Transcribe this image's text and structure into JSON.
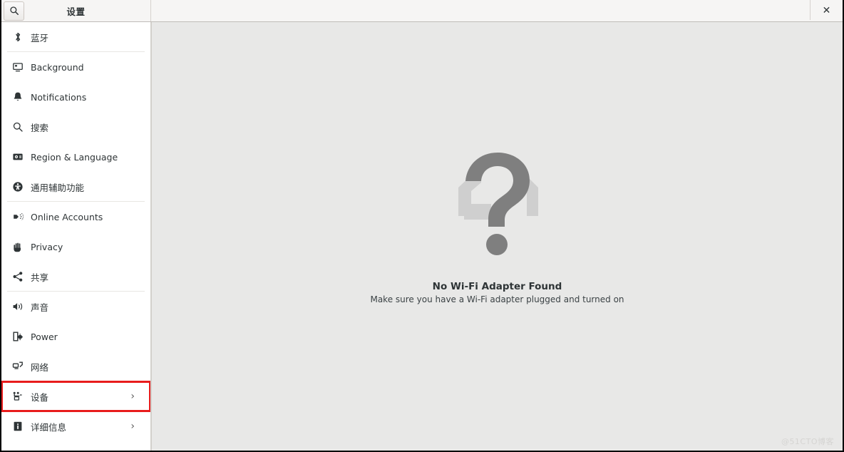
{
  "window": {
    "title": "设置",
    "search_icon": "search-icon",
    "close_label": "✕"
  },
  "sidebar": {
    "items": [
      {
        "label": "蓝牙",
        "icon": "bluetooth-icon",
        "chevron": "",
        "separator_after": true,
        "highlighted": false
      },
      {
        "label": "Background",
        "icon": "background-icon",
        "chevron": "",
        "separator_after": false,
        "highlighted": false
      },
      {
        "label": "Notifications",
        "icon": "bell-icon",
        "chevron": "",
        "separator_after": false,
        "highlighted": false
      },
      {
        "label": "搜索",
        "icon": "search-icon",
        "chevron": "",
        "separator_after": false,
        "highlighted": false
      },
      {
        "label": "Region & Language",
        "icon": "region-language-icon",
        "chevron": "",
        "separator_after": false,
        "highlighted": false
      },
      {
        "label": "通用辅助功能",
        "icon": "accessibility-icon",
        "chevron": "",
        "separator_after": true,
        "highlighted": false
      },
      {
        "label": "Online Accounts",
        "icon": "online-accounts-icon",
        "chevron": "",
        "separator_after": false,
        "highlighted": false
      },
      {
        "label": "Privacy",
        "icon": "privacy-hand-icon",
        "chevron": "",
        "separator_after": false,
        "highlighted": false
      },
      {
        "label": "共享",
        "icon": "sharing-icon",
        "chevron": "",
        "separator_after": true,
        "highlighted": false
      },
      {
        "label": "声音",
        "icon": "sound-icon",
        "chevron": "",
        "separator_after": false,
        "highlighted": false
      },
      {
        "label": "Power",
        "icon": "power-icon",
        "chevron": "",
        "separator_after": false,
        "highlighted": false
      },
      {
        "label": "网络",
        "icon": "network-icon",
        "chevron": "",
        "separator_after": false,
        "highlighted": false
      },
      {
        "label": "设备",
        "icon": "devices-icon",
        "chevron": "›",
        "separator_after": false,
        "highlighted": true
      },
      {
        "label": "详细信息",
        "icon": "details-info-icon",
        "chevron": "›",
        "separator_after": false,
        "highlighted": false
      }
    ]
  },
  "main": {
    "empty_state": {
      "icon": "question-mark-icon",
      "title": "No Wi-Fi Adapter Found",
      "subtitle": "Make sure you have a Wi-Fi adapter plugged and turned on"
    },
    "watermark": "@51CTO博客"
  },
  "colors": {
    "highlight_red": "#e81c1c",
    "titlebar_bg": "#f6f5f4",
    "content_bg": "#e8e8e7",
    "sidebar_bg": "#ffffff",
    "text": "#2e3436",
    "question_mark": "#7f7f7f",
    "question_mark_light": "#cfcfcf"
  }
}
